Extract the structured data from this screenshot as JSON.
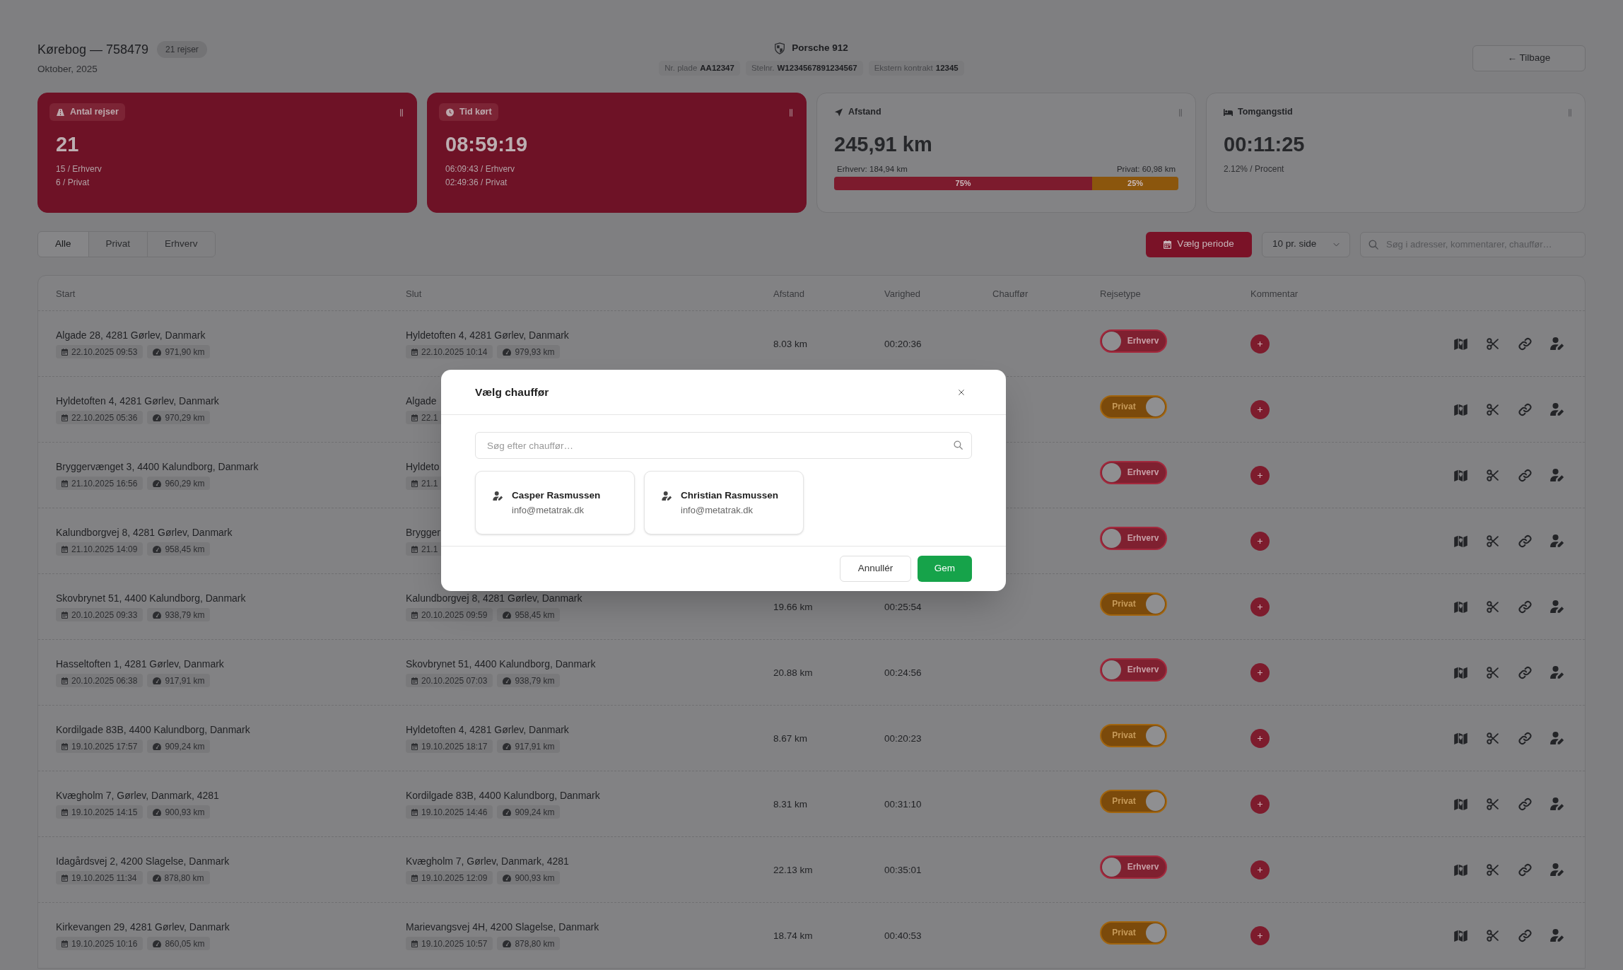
{
  "header": {
    "title": "Kørebog — 758479",
    "badge": "21 rejser",
    "subtitle": "Oktober, 2025",
    "vehicle": {
      "name": "Porsche 912",
      "fields": [
        {
          "label": "Nr. plade",
          "value": "AA12347"
        },
        {
          "label": "Stelnr.",
          "value": "W1234567891234567"
        },
        {
          "label": "Ekstern kontrakt",
          "value": "12345"
        }
      ]
    },
    "back_button": "← Tilbage"
  },
  "stats": [
    {
      "kind": "trips",
      "highlighted": true,
      "label": "Antal rejser",
      "value": "21",
      "details": [
        "15 / Erhverv",
        "6 / Privat"
      ]
    },
    {
      "kind": "time",
      "highlighted": true,
      "label": "Tid kørt",
      "value": "08:59:19",
      "details": [
        "06:09:43 / Erhverv",
        "02:49:36 / Privat"
      ]
    },
    {
      "kind": "distance",
      "highlighted": false,
      "label": "Afstand",
      "value": "245,91 km",
      "split": {
        "left": "Erhverv: 184,94 km",
        "right": "Privat: 60,98 km",
        "segments": [
          {
            "label": "75%",
            "level": 0.75,
            "color": "#7c1b2d"
          },
          {
            "label": "25%",
            "level": 0.25,
            "color": "#8b560d"
          }
        ]
      }
    },
    {
      "kind": "idle",
      "highlighted": false,
      "label": "Tomgangstid",
      "value": "00:11:25",
      "details": [
        "2.12% / Procent"
      ]
    }
  ],
  "filters": [
    {
      "label": "Alle",
      "selected": true
    },
    {
      "label": "Privat",
      "selected": false
    },
    {
      "label": "Erhverv",
      "selected": false
    }
  ],
  "toolbar": {
    "period_button": "Vælg periode",
    "page_size": "10 pr. side",
    "search_placeholder": "Søg i adresser, kommentarer, chauffør…"
  },
  "table": {
    "columns": [
      "Start",
      "Slut",
      "Afstand",
      "Varighed",
      "Chauffør",
      "Rejsetype",
      "Kommentar"
    ],
    "rows": [
      {
        "start": {
          "address": "Algade 28, 4281 Gørlev, Danmark",
          "time": "22.10.2025 09:53",
          "odometer": "971,90 km"
        },
        "end": {
          "address": "Hyldetoften 4, 4281 Gørlev, Danmark",
          "time": "22.10.2025 10:14",
          "odometer": "979,93 km"
        },
        "distance": "8.03 km",
        "duration": "00:20:36",
        "trip_type": {
          "label": "Erhverv",
          "on": false
        }
      },
      {
        "start": {
          "address": "Hyldetoften 4, 4281 Gørlev, Danmark",
          "time": "22.10.2025 05:36",
          "odometer": "970,29 km"
        },
        "end": {
          "address": "Algade",
          "time": "22.1"
        },
        "trip_type": {
          "label": "Privat",
          "on": true
        }
      },
      {
        "start": {
          "address": "Bryggervænget 3, 4400 Kalundborg, Danmark",
          "time": "21.10.2025 16:56",
          "odometer": "960,29 km"
        },
        "end": {
          "address": "Hyldeto",
          "time": "21.1"
        },
        "trip_type": {
          "label": "Erhverv",
          "on": false
        }
      },
      {
        "start": {
          "address": "Kalundborgvej 8, 4281 Gørlev, Danmark",
          "time": "21.10.2025 14:09",
          "odometer": "958,45 km"
        },
        "end": {
          "address": "Brygger",
          "time": "21.1"
        },
        "trip_type": {
          "label": "Erhverv",
          "on": false
        }
      },
      {
        "start": {
          "address": "Skovbrynet 51, 4400 Kalundborg, Danmark",
          "time": "20.10.2025 09:33",
          "odometer": "938,79 km"
        },
        "end": {
          "address": "Kalundborgvej 8, 4281 Gørlev, Danmark",
          "time": "20.10.2025 09:59",
          "odometer": "958,45 km"
        },
        "distance": "19.66 km",
        "duration": "00:25:54",
        "trip_type": {
          "label": "Privat",
          "on": true
        }
      },
      {
        "start": {
          "address": "Hasseltoften 1, 4281 Gørlev, Danmark",
          "time": "20.10.2025 06:38",
          "odometer": "917,91 km"
        },
        "end": {
          "address": "Skovbrynet 51, 4400 Kalundborg, Danmark",
          "time": "20.10.2025 07:03",
          "odometer": "938,79 km"
        },
        "distance": "20.88 km",
        "duration": "00:24:56",
        "trip_type": {
          "label": "Erhverv",
          "on": false
        }
      },
      {
        "start": {
          "address": "Kordilgade 83B, 4400 Kalundborg, Danmark",
          "time": "19.10.2025 17:57",
          "odometer": "909,24 km"
        },
        "end": {
          "address": "Hyldetoften 4, 4281 Gørlev, Danmark",
          "time": "19.10.2025 18:17",
          "odometer": "917,91 km"
        },
        "distance": "8.67 km",
        "duration": "00:20:23",
        "trip_type": {
          "label": "Privat",
          "on": true
        }
      },
      {
        "start": {
          "address": "Kvægholm 7, Gørlev, Danmark, 4281",
          "time": "19.10.2025 14:15",
          "odometer": "900,93 km"
        },
        "end": {
          "address": "Kordilgade 83B, 4400 Kalundborg, Danmark",
          "time": "19.10.2025 14:46",
          "odometer": "909,24 km"
        },
        "distance": "8.31 km",
        "duration": "00:31:10",
        "trip_type": {
          "label": "Privat",
          "on": true
        }
      },
      {
        "start": {
          "address": "Idagårdsvej 2, 4200 Slagelse, Danmark",
          "time": "19.10.2025 11:34",
          "odometer": "878,80 km"
        },
        "end": {
          "address": "Kvægholm 7, Gørlev, Danmark, 4281",
          "time": "19.10.2025 12:09",
          "odometer": "900,93 km"
        },
        "distance": "22.13 km",
        "duration": "00:35:01",
        "trip_type": {
          "label": "Erhverv",
          "on": false
        }
      },
      {
        "start": {
          "address": "Kirkevangen 29, 4281 Gørlev, Danmark",
          "time": "19.10.2025 10:16",
          "odometer": "860,05 km"
        },
        "end": {
          "address": "Marievangsvej 4H, 4200 Slagelse, Danmark",
          "time": "19.10.2025 10:57",
          "odometer": "878,80 km"
        },
        "distance": "18.74 km",
        "duration": "00:40:53",
        "trip_type": {
          "label": "Privat",
          "on": true
        }
      }
    ]
  },
  "driver_dialog": {
    "title": "Vælg chauffør",
    "search_placeholder": "Søg efter chauffør…",
    "drivers": [
      {
        "name": "Casper Rasmussen",
        "email": "info@metatrak.dk",
        "selected": false
      },
      {
        "name": "Christian Rasmussen",
        "email": "info@metatrak.dk",
        "selected": false
      }
    ],
    "buttons": [
      {
        "kind": "secondary",
        "label": "Annullér"
      },
      {
        "kind": "primary",
        "label": "Gem"
      }
    ]
  }
}
